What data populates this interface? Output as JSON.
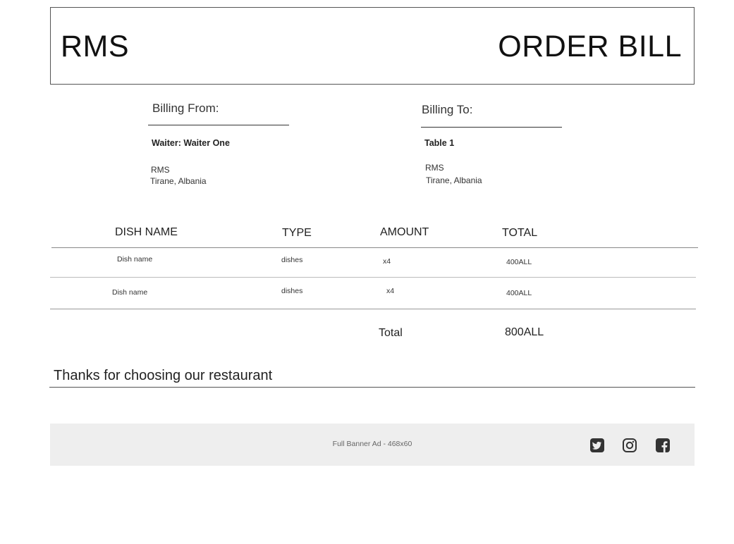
{
  "header": {
    "brand": "RMS",
    "title": "ORDER BILL"
  },
  "billing_from": {
    "heading": "Billing From:",
    "waiter": "Waiter: Waiter One",
    "company": "RMS",
    "address": "Tirane, Albania"
  },
  "billing_to": {
    "heading": "Billing To:",
    "table": "Table 1",
    "company": "RMS",
    "address": "Tirane, Albania"
  },
  "table": {
    "headers": [
      "DISH NAME",
      "TYPE",
      "AMOUNT",
      "TOTAL"
    ],
    "rows": [
      {
        "name": "Dish name",
        "type": "dishes",
        "amount": "x4",
        "total": "400ALL"
      },
      {
        "name": "Dish name",
        "type": "dishes",
        "amount": "x4",
        "total": "400ALL"
      }
    ]
  },
  "summary": {
    "label": "Total",
    "value": "800ALL"
  },
  "thanks": "Thanks for choosing our restaurant",
  "footer": {
    "banner_text": "Full Banner Ad - 468x60",
    "social_icons": [
      "twitter-icon",
      "instagram-icon",
      "facebook-icon"
    ]
  }
}
